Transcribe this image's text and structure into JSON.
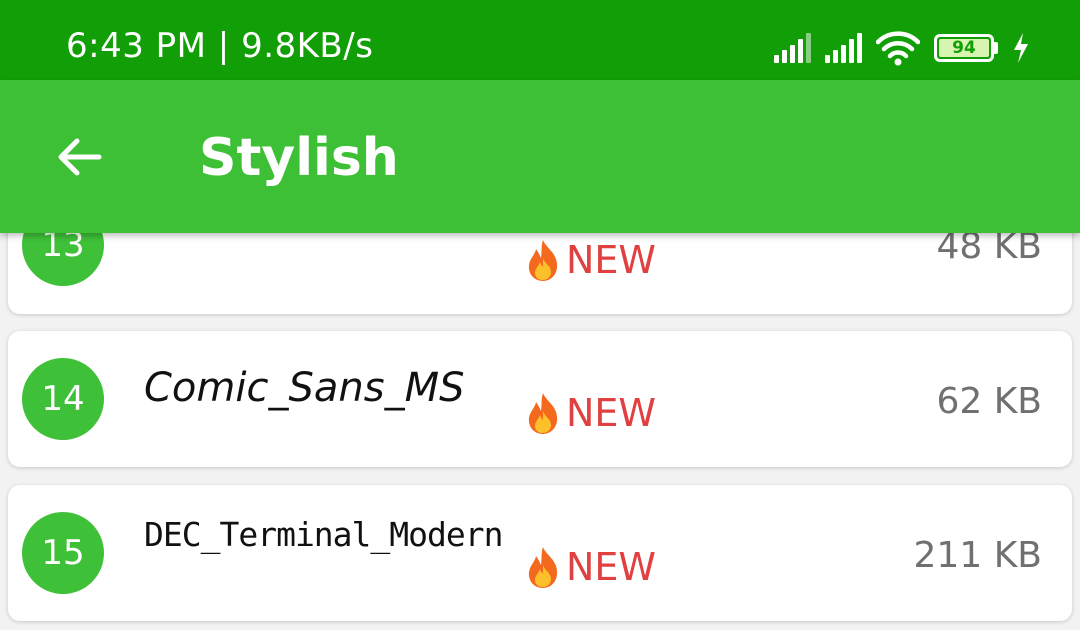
{
  "status_bar": {
    "text": "6:43 PM | 9.8KB/s",
    "battery_level": "94",
    "icons": [
      "signal-icon",
      "signal-icon",
      "wifi-icon",
      "battery-icon",
      "charging-icon"
    ]
  },
  "app_bar": {
    "title": "Stylish",
    "back_icon": "arrow-left-icon"
  },
  "fonts": [
    {
      "number": "13",
      "name": "",
      "badge": "NEW",
      "badge_icon": "fire-icon",
      "size": "48 KB"
    },
    {
      "number": "14",
      "name": "Comic_Sans_MS",
      "badge": "NEW",
      "badge_icon": "fire-icon",
      "size": "62 KB"
    },
    {
      "number": "15",
      "name": "DEC_Terminal_Modern",
      "badge": "NEW",
      "badge_icon": "fire-icon",
      "size": "211 KB"
    }
  ],
  "colors": {
    "status_bar": "#119e06",
    "app_bar": "#3ec036",
    "number_circle": "#3ec038",
    "badge_text": "#e04040"
  }
}
